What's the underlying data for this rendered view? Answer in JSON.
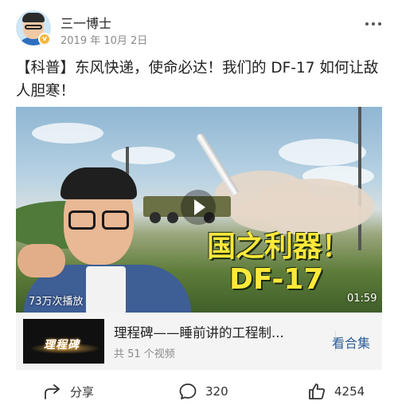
{
  "post": {
    "author": "三一博士",
    "date": "2019 年 10月 2日",
    "text": "【科普】东风快递，使命必达！我们的 DF-17 如何让敌人胆寒！"
  },
  "video": {
    "overlay_line1": "国之利器！",
    "overlay_line2": "DF-17",
    "views": "73万次播放",
    "duration": "01:59"
  },
  "collection": {
    "thumb_text": "理程碑",
    "title": "理程碑——睡前讲的工程制...",
    "count": "共 51 个视频",
    "link": "看合集"
  },
  "actions": {
    "share_label": "分享",
    "comment_count": "320",
    "like_count": "4254"
  },
  "icons": [
    "more-icon",
    "share-icon",
    "comment-icon",
    "like-icon",
    "verified-badge-icon",
    "play-icon"
  ],
  "colors": {
    "link": "#2f5e99",
    "overlay_text": "#ffe93a",
    "badge": "#f6b73c"
  }
}
